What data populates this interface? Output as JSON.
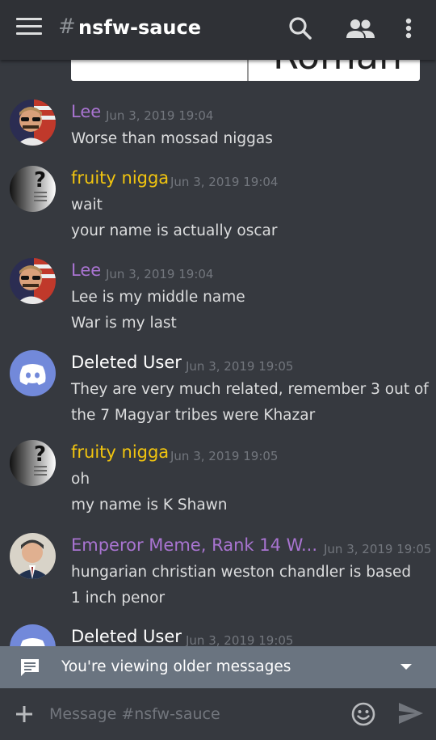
{
  "header": {
    "hash": "#",
    "channel": "nsfw-sauce"
  },
  "embed": {
    "visible_word": "Roman"
  },
  "messages": [
    {
      "author": "Lee",
      "author_color": "#a974d1",
      "timestamp": "Jun 3, 2019 19:04",
      "avatar": "user-avatar-lee",
      "lines": [
        "Worse than mossad niggas"
      ]
    },
    {
      "author": "fruity nigga",
      "author_color": "#f1c40f",
      "timestamp": "Jun 3, 2019 19:04",
      "avatar": "user-avatar-fruity",
      "lines": [
        "wait",
        "your name is actually oscar"
      ]
    },
    {
      "author": "Lee",
      "author_color": "#a974d1",
      "timestamp": "Jun 3, 2019 19:04",
      "avatar": "user-avatar-lee",
      "lines": [
        "Lee is my middle name",
        "War is my last"
      ]
    },
    {
      "author": "Deleted User",
      "author_color": "#ffffff",
      "timestamp": "Jun 3, 2019 19:05",
      "avatar": "discord-default-avatar",
      "lines": [
        "They are very much related, remember 3 out of",
        "the 7 Magyar tribes were Khazar"
      ]
    },
    {
      "author": "fruity nigga",
      "author_color": "#f1c40f",
      "timestamp": "Jun 3, 2019 19:05",
      "avatar": "user-avatar-fruity",
      "lines": [
        "oh",
        "my name is K Shawn"
      ]
    },
    {
      "author": "Emperor Meme, Rank 14 W...",
      "author_color": "#a974d1",
      "timestamp": "Jun 3, 2019 19:05",
      "avatar": "user-avatar-emperor",
      "lines": [
        "hungarian christian weston chandler is based",
        "1 inch penor"
      ]
    },
    {
      "author": "Deleted User",
      "author_color": "#ffffff",
      "timestamp": "Jun 3, 2019 19:05",
      "avatar": "discord-default-avatar",
      "lines": []
    }
  ],
  "older_banner": {
    "label": "You're viewing older messages"
  },
  "composer": {
    "placeholder": "Message #nsfw-sauce"
  },
  "colors": {
    "background": "#36393f",
    "topbar": "#2f3136",
    "older_banner": "#6a7480",
    "discord_blurple": "#7289da",
    "timestamp": "#72767d"
  }
}
